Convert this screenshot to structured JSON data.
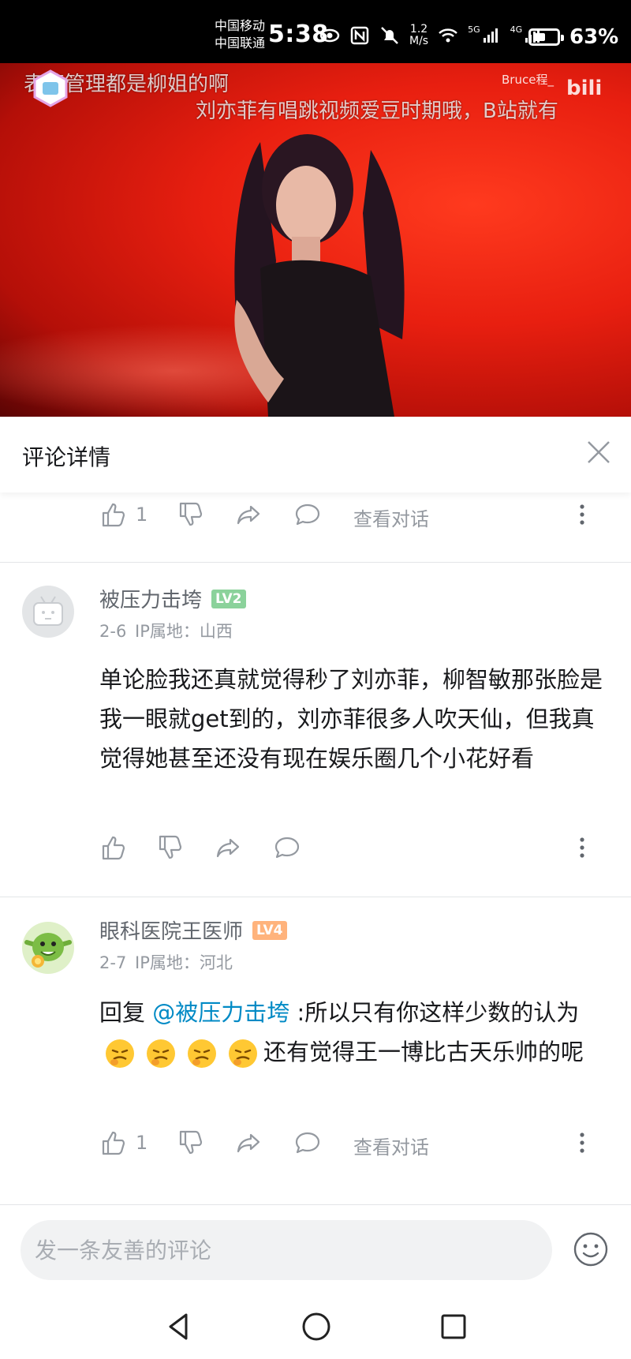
{
  "status_bar": {
    "carrier_1": "中国移动",
    "carrier_2": "中国联通",
    "time": "5:38",
    "net_speed_value": "1.2",
    "net_speed_unit": "M/s",
    "signal_1": "5G",
    "signal_2": "4G",
    "battery_level": 0.63,
    "battery_text": "63%"
  },
  "video": {
    "danmaku_1": "表情管理都是柳姐的啊",
    "danmaku_2": "刘亦菲有唱跳视频爱豆时期哦，B站就有",
    "watermark": "Bruce程_",
    "progress": 0.58,
    "accent_color": "#fb7299"
  },
  "header": {
    "title": "评论详情"
  },
  "top_actions": {
    "like_count": "1",
    "view_thread": "查看对话"
  },
  "comments": [
    {
      "username": "被压力击垮",
      "level": "LV2",
      "date": "2-6",
      "ip_location": "IP属地：山西",
      "content": "单论脸我还真就觉得秒了刘亦菲，柳智敏那张脸是我一眼就get到的，刘亦菲很多人吹天仙，但我真觉得她甚至还没有现在娱乐圈几个小花好看"
    },
    {
      "username": "眼科医院王医师",
      "level": "LV4",
      "date": "2-7",
      "ip_location": "IP属地：河北",
      "reply_prefix": "回复 ",
      "mention": "@被压力击垮",
      "content_part1": " :所以只有你这样少数的认为",
      "content_part2": "还有觉得王一博比古天乐帅的呢",
      "like_count": "1",
      "view_thread": "查看对话"
    }
  ],
  "input": {
    "placeholder": "发一条友善的评论"
  }
}
